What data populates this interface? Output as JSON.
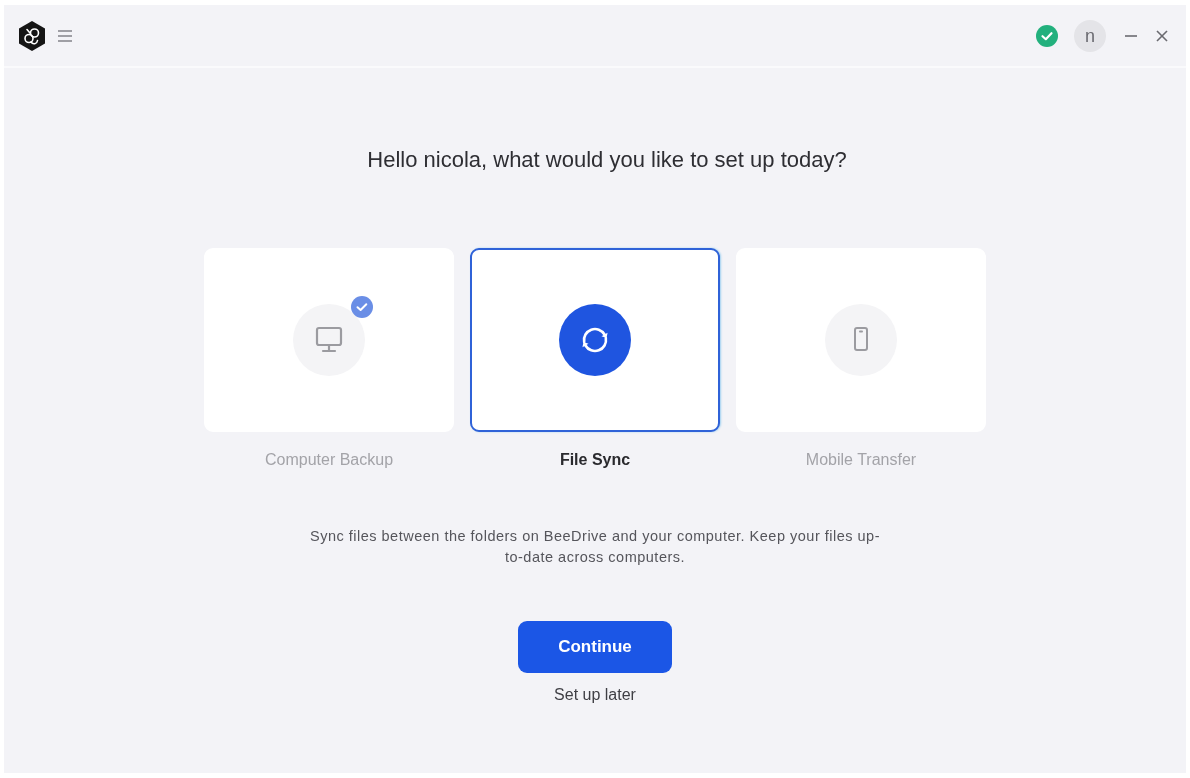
{
  "header": {
    "avatar_initial": "n"
  },
  "title": "Hello nicola, what would you like to set up today?",
  "options": [
    {
      "label": "Computer Backup",
      "kind": "computer",
      "selected": false,
      "configured": true
    },
    {
      "label": "File Sync",
      "kind": "sync",
      "selected": true,
      "configured": false
    },
    {
      "label": "Mobile Transfer",
      "kind": "phone",
      "selected": false,
      "configured": false
    }
  ],
  "description": "Sync files between the folders on BeeDrive and your computer. Keep your files up-to-date across computers.",
  "primary_button": "Continue",
  "secondary_link": "Set up later"
}
